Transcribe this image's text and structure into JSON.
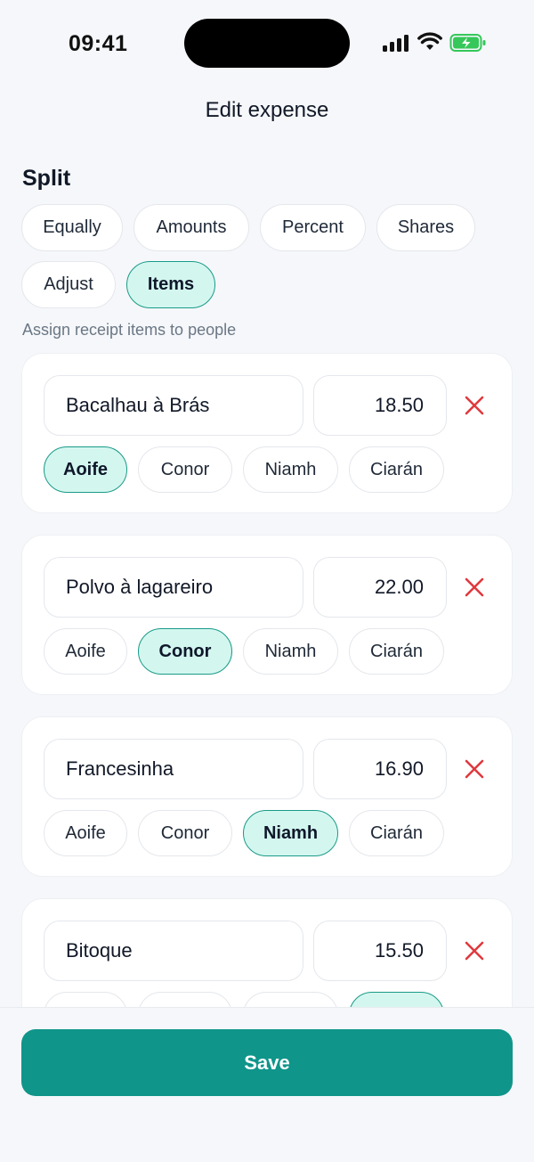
{
  "status_bar": {
    "time": "09:41"
  },
  "header": {
    "title": "Edit expense"
  },
  "split": {
    "title": "Split",
    "modes": [
      "Equally",
      "Amounts",
      "Percent",
      "Shares",
      "Adjust",
      "Items"
    ],
    "selected_mode": "Items",
    "helper": "Assign receipt items to people"
  },
  "people": [
    "Aoife",
    "Conor",
    "Niamh",
    "Ciarán"
  ],
  "items": [
    {
      "name": "Bacalhau à Brás",
      "amount": "18.50",
      "assigned": "Aoife"
    },
    {
      "name": "Polvo à lagareiro",
      "amount": "22.00",
      "assigned": "Conor"
    },
    {
      "name": "Francesinha",
      "amount": "16.90",
      "assigned": "Niamh"
    },
    {
      "name": "Bitoque",
      "amount": "15.50",
      "assigned": "Ciarán"
    }
  ],
  "footer": {
    "save_label": "Save"
  },
  "colors": {
    "accent": "#0f958a",
    "selected_chip_bg": "#d3f7ef",
    "remove": "#e0393e"
  }
}
